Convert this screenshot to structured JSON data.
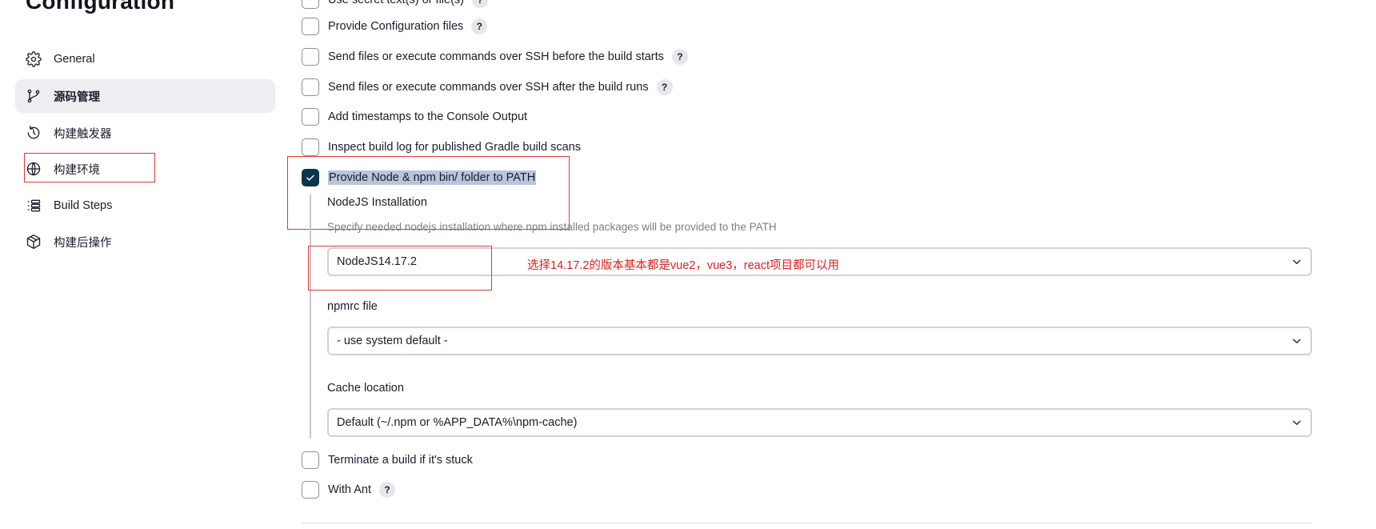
{
  "page": {
    "title": "Configuration"
  },
  "sidebar": {
    "items": [
      {
        "label": "General",
        "icon": "gear-icon",
        "active": false
      },
      {
        "label": "源码管理",
        "icon": "git-branch-icon",
        "active": true
      },
      {
        "label": "构建触发器",
        "icon": "clock-icon",
        "active": false
      },
      {
        "label": "构建环境",
        "icon": "globe-icon",
        "active": false
      },
      {
        "label": "Build Steps",
        "icon": "list-icon",
        "active": false
      },
      {
        "label": "构建后操作",
        "icon": "package-icon",
        "active": false
      }
    ]
  },
  "options": {
    "partial_top": "Use secret text(s) or file(s)",
    "provide_config": "Provide Configuration files",
    "ssh_before": "Send files or execute commands over SSH before the build starts",
    "ssh_after": "Send files or execute commands over SSH after the build runs",
    "timestamps": "Add timestamps to the Console Output",
    "inspect_gradle": "Inspect build log for published Gradle build scans",
    "provide_node": "Provide Node & npm bin/ folder to PATH",
    "terminate_stuck": "Terminate a build if it's stuck",
    "with_ant": "With Ant",
    "help_symbol": "?"
  },
  "node": {
    "installation_label": "NodeJS Installation",
    "installation_desc": "Specify needed nodejs installation where npm installed packages will be provided to the PATH",
    "installation_value": "NodeJS14.17.2",
    "npmrc_label": "npmrc file",
    "npmrc_value": "- use system default -",
    "cache_label": "Cache location",
    "cache_value": "Default (~/.npm or %APP_DATA%\\npm-cache)"
  },
  "annotation": {
    "text": "选择14.17.2的版本基本都是vue2，vue3，react项目都可以用",
    "color": "#e02020"
  },
  "colors": {
    "checkbox_checked": "#0a3650",
    "active_nav_bg": "#eceef2",
    "annotation_box": "#e53935"
  }
}
